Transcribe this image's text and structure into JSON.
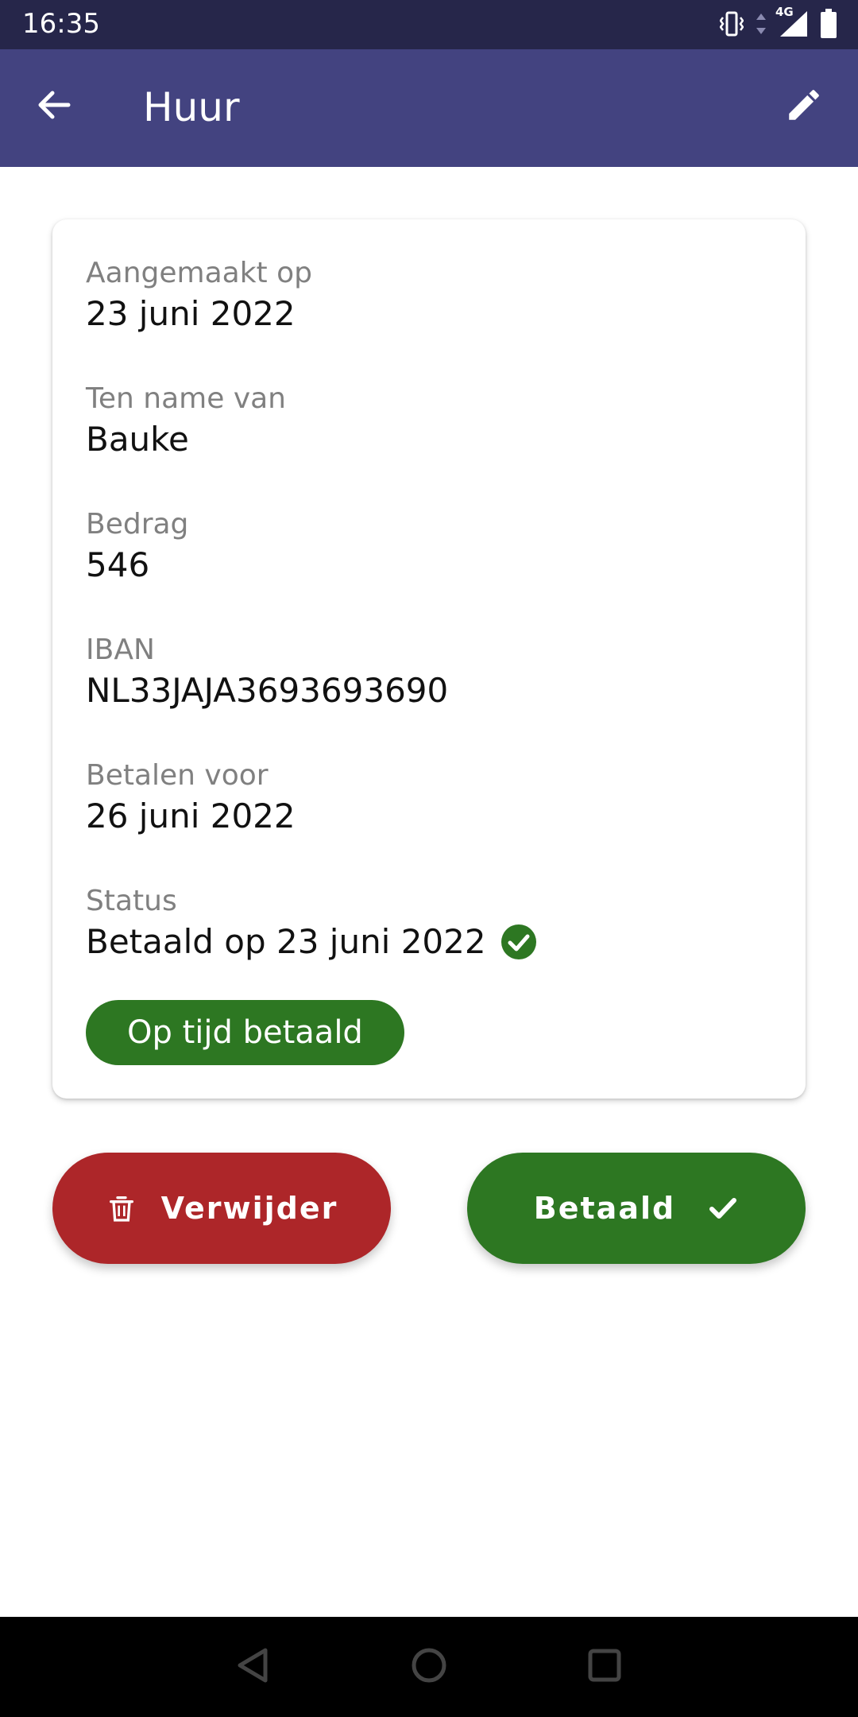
{
  "status_bar": {
    "time": "16:35",
    "network_label": "4G",
    "icons": [
      "vibrate-icon",
      "data-arrows-icon",
      "signal-icon",
      "battery-icon"
    ]
  },
  "app_bar": {
    "title": "Huur",
    "back_icon": "arrow-back-icon",
    "edit_icon": "pencil-icon"
  },
  "details": {
    "created_label": "Aangemaakt op",
    "created_value": "23 juni 2022",
    "name_label": "Ten name van",
    "name_value": "Bauke",
    "amount_label": "Bedrag",
    "amount_value": "546",
    "iban_label": "IBAN",
    "iban_value": "NL33JAJA3693693690",
    "due_label": "Betalen voor",
    "due_value": "26 juni 2022",
    "status_label": "Status",
    "status_value": "Betaald op 23 juni 2022",
    "status_icon": "check-circle-icon",
    "badge": "Op tijd betaald"
  },
  "actions": {
    "delete_label": "Verwijder",
    "delete_icon": "trash-icon",
    "paid_label": "Betaald",
    "paid_icon": "check-icon"
  },
  "colors": {
    "app_bar": "#434380",
    "status_bar": "#26264a",
    "success": "#2d7722",
    "danger": "#ad2629"
  },
  "nav": {
    "icons": [
      "nav-back-icon",
      "nav-home-icon",
      "nav-recents-icon"
    ]
  }
}
